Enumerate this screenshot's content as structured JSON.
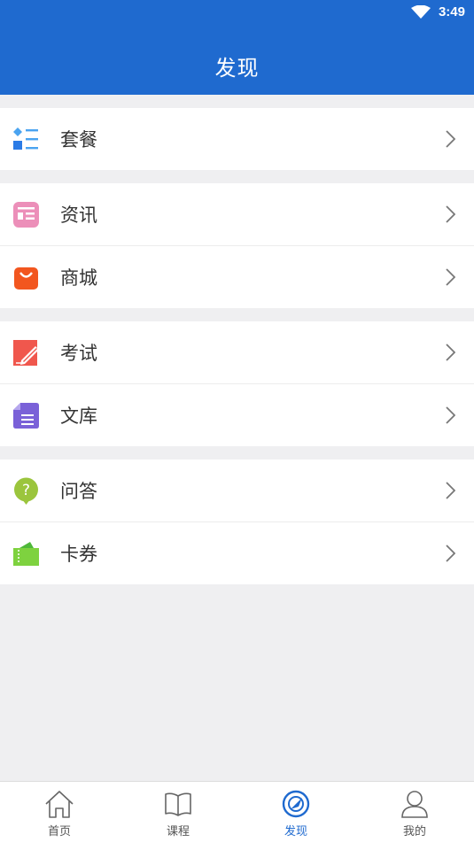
{
  "status_bar": {
    "time": "3:49"
  },
  "header": {
    "title": "发现"
  },
  "groups": [
    {
      "items": [
        {
          "label": "套餐",
          "icon": "package-icon"
        }
      ]
    },
    {
      "items": [
        {
          "label": "资讯",
          "icon": "news-icon"
        },
        {
          "label": "商城",
          "icon": "shop-bag-icon"
        }
      ]
    },
    {
      "items": [
        {
          "label": "考试",
          "icon": "exam-pen-icon"
        },
        {
          "label": "文库",
          "icon": "document-icon"
        }
      ]
    },
    {
      "items": [
        {
          "label": "问答",
          "icon": "question-bubble-icon"
        },
        {
          "label": "卡券",
          "icon": "ticket-icon"
        }
      ]
    }
  ],
  "tabbar": {
    "items": [
      {
        "label": "首页",
        "icon": "home-icon"
      },
      {
        "label": "课程",
        "icon": "book-icon"
      },
      {
        "label": "发现",
        "icon": "compass-icon",
        "active": true
      },
      {
        "label": "我的",
        "icon": "user-icon"
      }
    ]
  },
  "colors": {
    "primary": "#1f6acf",
    "background": "#efeff1"
  }
}
